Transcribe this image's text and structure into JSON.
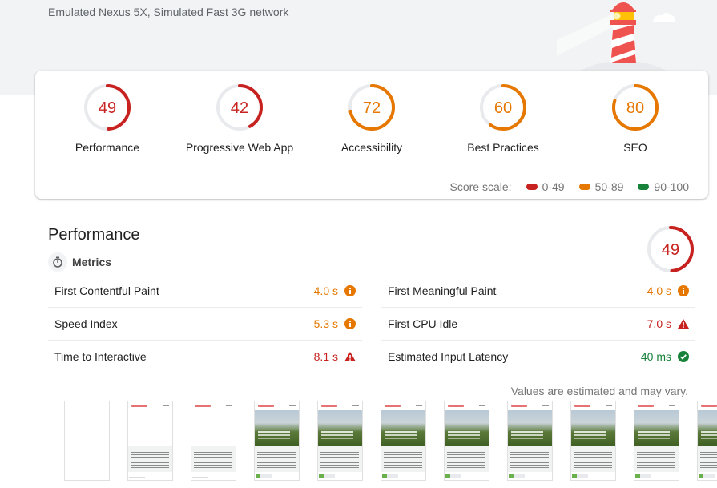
{
  "header": {
    "environment": "Emulated Nexus 5X, Simulated Fast 3G network"
  },
  "colors": {
    "fail": "#c7221f",
    "average": "#e67700",
    "pass": "#178239",
    "track": "#e8eaed"
  },
  "categories": [
    {
      "label": "Performance",
      "score": 49,
      "rating": "fail"
    },
    {
      "label": "Progressive Web App",
      "score": 42,
      "rating": "fail"
    },
    {
      "label": "Accessibility",
      "score": 72,
      "rating": "average"
    },
    {
      "label": "Best Practices",
      "score": 60,
      "rating": "average"
    },
    {
      "label": "SEO",
      "score": 80,
      "rating": "average"
    }
  ],
  "score_scale": {
    "label": "Score scale:",
    "ranges": [
      {
        "label": "0-49",
        "rating": "fail"
      },
      {
        "label": "50-89",
        "rating": "average"
      },
      {
        "label": "90-100",
        "rating": "pass"
      }
    ]
  },
  "performance": {
    "title": "Performance",
    "score": 49,
    "metrics_label": "Metrics",
    "metrics_left": [
      {
        "name": "First Contentful Paint",
        "value": "4.0 s",
        "rating": "average",
        "icon": "info-icon"
      },
      {
        "name": "Speed Index",
        "value": "5.3 s",
        "rating": "average",
        "icon": "info-icon"
      },
      {
        "name": "Time to Interactive",
        "value": "8.1 s",
        "rating": "fail",
        "icon": "warning-icon"
      }
    ],
    "metrics_right": [
      {
        "name": "First Meaningful Paint",
        "value": "4.0 s",
        "rating": "average",
        "icon": "info-icon"
      },
      {
        "name": "First CPU Idle",
        "value": "7.0 s",
        "rating": "fail",
        "icon": "warning-icon"
      },
      {
        "name": "Estimated Input Latency",
        "value": "40 ms",
        "rating": "pass",
        "icon": "check-icon"
      }
    ],
    "note": "Values are estimated and may vary.",
    "filmstrip": [
      "blank",
      "loading",
      "loading",
      "loaded",
      "loaded",
      "loaded",
      "loaded",
      "loaded",
      "loaded",
      "loaded",
      "loaded"
    ]
  }
}
